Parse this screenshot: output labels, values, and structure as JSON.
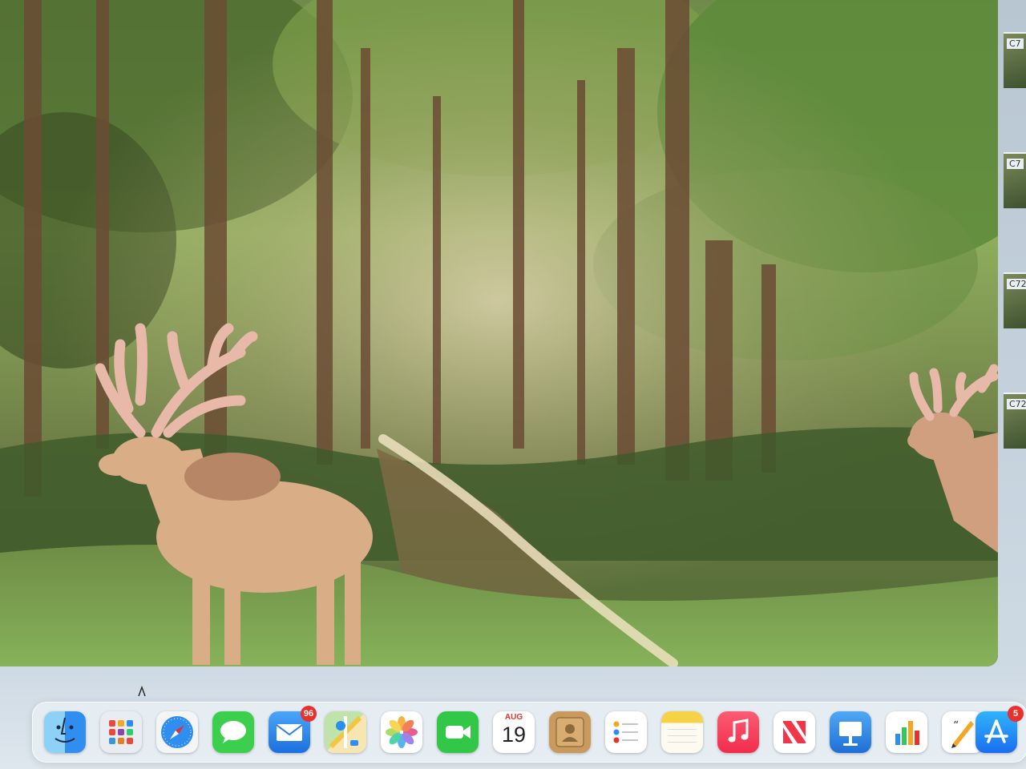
{
  "thumbnails": [
    {
      "label": "C7"
    },
    {
      "label": "C7"
    },
    {
      "label": "C72"
    },
    {
      "label": "C72"
    }
  ],
  "dock": {
    "items": [
      {
        "name": "finder",
        "icon": "finder-icon"
      },
      {
        "name": "launchpad",
        "icon": "launchpad-icon"
      },
      {
        "name": "safari",
        "icon": "safari-icon"
      },
      {
        "name": "messages",
        "icon": "messages-icon"
      },
      {
        "name": "mail",
        "icon": "mail-icon",
        "badge": "96"
      },
      {
        "name": "maps",
        "icon": "maps-icon"
      },
      {
        "name": "photos",
        "icon": "photos-icon"
      },
      {
        "name": "facetime",
        "icon": "facetime-icon"
      },
      {
        "name": "calendar",
        "icon": "calendar-icon",
        "month": "AUG",
        "day": "19"
      },
      {
        "name": "contacts",
        "icon": "contacts-icon"
      },
      {
        "name": "reminders",
        "icon": "reminders-icon"
      },
      {
        "name": "notes",
        "icon": "notes-icon"
      },
      {
        "name": "music",
        "icon": "music-icon"
      },
      {
        "name": "news",
        "icon": "news-icon"
      },
      {
        "name": "keynote",
        "icon": "keynote-icon"
      },
      {
        "name": "numbers",
        "icon": "numbers-icon"
      },
      {
        "name": "pages",
        "icon": "pages-icon"
      },
      {
        "name": "app-store",
        "icon": "app-store-icon",
        "badge": "5"
      }
    ]
  },
  "colors": {
    "badge": "#e8302c",
    "dock_bg": "#e8eef3"
  }
}
